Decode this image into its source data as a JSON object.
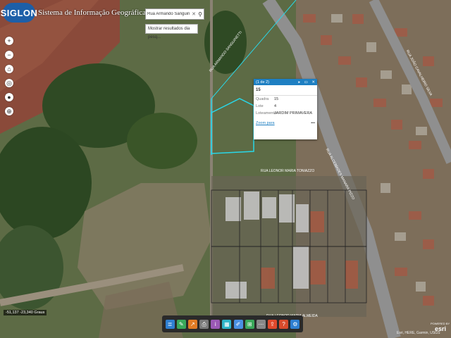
{
  "app": {
    "logo_text": "SIGLON",
    "title": "Sistema de Informação Geográfica de Londrina"
  },
  "search": {
    "value": "Rua Armando Sanguinetti",
    "clear_icon": "close-icon",
    "search_icon": "search-icon",
    "suggestion": "Mostrar resultados dia pesq..."
  },
  "map_tools": [
    {
      "name": "zoom-in",
      "glyph": "+"
    },
    {
      "name": "zoom-out",
      "glyph": "−"
    },
    {
      "name": "home",
      "glyph": "⌂"
    },
    {
      "name": "locate",
      "glyph": "◎"
    },
    {
      "name": "layers",
      "glyph": "●"
    },
    {
      "name": "compass",
      "glyph": "⊕"
    }
  ],
  "popup": {
    "count": "(1 de 2)",
    "title": "15",
    "rows": [
      {
        "label": "Quadra",
        "value": "15"
      },
      {
        "label": "Lote",
        "value": "4"
      },
      {
        "label": "Loteamento",
        "value": "JARDIM PRIMAVERA"
      }
    ],
    "zoom_link": "Zoom para",
    "more": "•••"
  },
  "street_labels": [
    "RUA ARMANDO SANGUINETTI",
    "RUA LEONOR MARIA TONIAZZO",
    "RUA ALCEBÍADES MANARA PIZZO",
    "RUA LEONOR MARIA ALMEIDA",
    "RUA JOÃO CAVALHEIRO SILVA"
  ],
  "coords": "-51,137 -23,340 Graus",
  "dock": [
    {
      "name": "layers",
      "color": "#2e7fd1",
      "glyph": "≣"
    },
    {
      "name": "draw",
      "color": "#3aa85a",
      "glyph": "✎"
    },
    {
      "name": "measure",
      "color": "#e07b24",
      "glyph": "↗"
    },
    {
      "name": "print",
      "color": "#7a7a7a",
      "glyph": "⎙"
    },
    {
      "name": "info",
      "color": "#9b59b6",
      "glyph": "i"
    },
    {
      "name": "legend",
      "color": "#2eb5c9",
      "glyph": "▦"
    },
    {
      "name": "edit",
      "color": "#4a90e2",
      "glyph": "✐"
    },
    {
      "name": "grid",
      "color": "#3aa85a",
      "glyph": "⊞"
    },
    {
      "name": "query",
      "color": "#888888",
      "glyph": "⋯"
    },
    {
      "name": "export",
      "color": "#e0492c",
      "glyph": "⇪"
    },
    {
      "name": "help",
      "color": "#d94b2b",
      "glyph": "?"
    },
    {
      "name": "settings",
      "color": "#2e7fd1",
      "glyph": "⚙"
    }
  ],
  "attribution": "Esri, HERE, Garmin, USGS",
  "esri_logo": "esri",
  "powered_by": "POWERED BY"
}
